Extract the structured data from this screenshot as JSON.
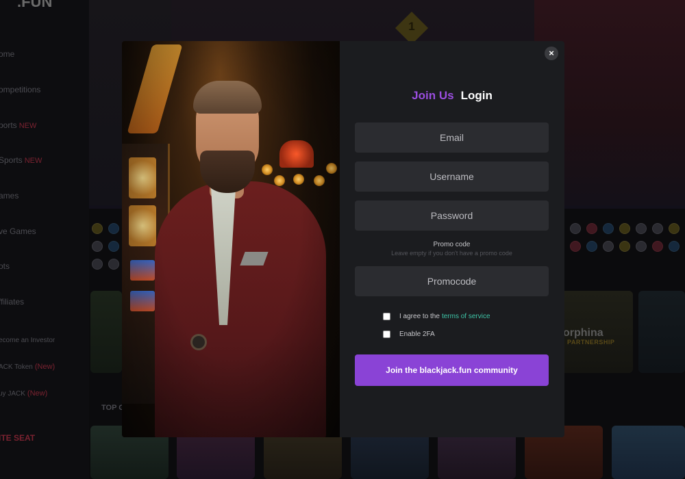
{
  "background": {
    "logo": ".FUN",
    "nav": [
      {
        "label": "ome",
        "badge": ""
      },
      {
        "label": "ompetitions",
        "badge": ""
      },
      {
        "label": "ports",
        "badge": "NEW"
      },
      {
        "label": "Sports",
        "badge": "NEW"
      },
      {
        "label": "ames",
        "badge": ""
      },
      {
        "label": "ve Games",
        "badge": ""
      },
      {
        "label": "ots",
        "badge": ""
      },
      {
        "label": "ffiliates",
        "badge": ""
      },
      {
        "label": "ecome an Investor",
        "badge": ""
      },
      {
        "label": "ACK Token",
        "badge": "(New)"
      },
      {
        "label": "uy JACK",
        "badge": "(New)"
      },
      {
        "label": "ITE SEAT",
        "badge": ""
      }
    ],
    "hero_badge": "1",
    "section_title": "TOP G",
    "partner_name": "orphina",
    "partner_sub": "PARTNERSHIP"
  },
  "modal": {
    "close_icon": "×",
    "tabs": [
      {
        "label": "Join Us",
        "active": true
      },
      {
        "label": "Login",
        "active": false
      }
    ],
    "email_placeholder": "Email",
    "username_placeholder": "Username",
    "password_placeholder": "Password",
    "promo_label": "Promo code",
    "promo_hint": "Leave empty if you don't have a promo code",
    "promocode_placeholder": "Promocode",
    "terms_prefix": "I agree to the",
    "terms_link": "terms of service",
    "twofa_label": "Enable 2FA",
    "submit_label": "Join the blackjack.fun community"
  },
  "colors": {
    "accent": "#8a43d6",
    "tab_active": "#9b4ee0",
    "link": "#3ec3a6",
    "modal_bg": "#1b1c1f",
    "field_bg": "#2b2c30"
  }
}
